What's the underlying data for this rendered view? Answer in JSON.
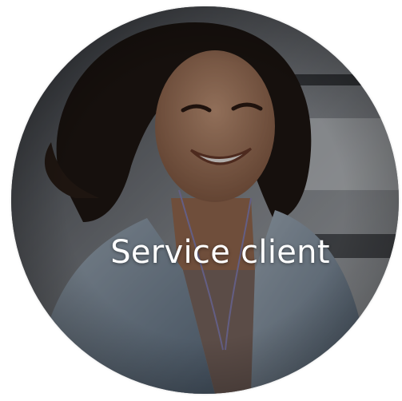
{
  "tile": {
    "label": "Service client",
    "icon": "customer-service-photo",
    "label_color": "#ffffff"
  }
}
